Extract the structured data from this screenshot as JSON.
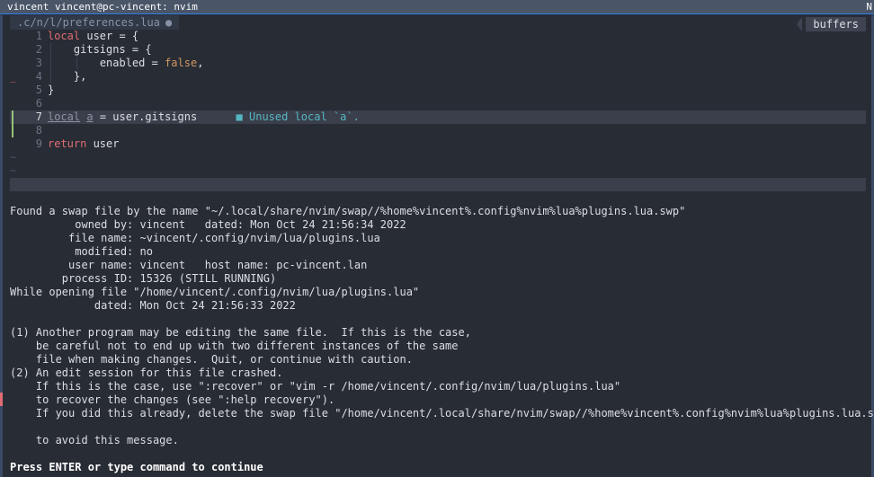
{
  "window": {
    "title": "vincent vincent@pc-vincent: nvim",
    "right_mark": "N"
  },
  "tabline": {
    "file": ".c/n/l/preferences.lua",
    "modified_icon": "●",
    "buffers_label": "buffers"
  },
  "editor": {
    "lines": [
      {
        "num": "1",
        "text": "local user = {"
      },
      {
        "num": "2",
        "text": "    gitsigns = {"
      },
      {
        "num": "3",
        "text": "        enabled = false,"
      },
      {
        "num": "4",
        "text": "    },"
      },
      {
        "num": "5",
        "text": "}"
      },
      {
        "num": "6",
        "text": ""
      },
      {
        "num": "7",
        "text": "local a = user.gitsigns"
      },
      {
        "num": "8",
        "text": ""
      },
      {
        "num": "9",
        "text": "return user"
      }
    ],
    "diagnostic": "■ Unused local `a`.",
    "tilde": "~"
  },
  "message": {
    "lines": [
      "Found a swap file by the name \"~/.local/share/nvim/swap//%home%vincent%.config%nvim%lua%plugins.lua.swp\"",
      "          owned by: vincent   dated: Mon Oct 24 21:56:34 2022",
      "         file name: ~vincent/.config/nvim/lua/plugins.lua",
      "          modified: no",
      "         user name: vincent   host name: pc-vincent.lan",
      "        process ID: 15326 (STILL RUNNING)",
      "While opening file \"/home/vincent/.config/nvim/lua/plugins.lua\"",
      "             dated: Mon Oct 24 21:56:33 2022",
      "",
      "(1) Another program may be editing the same file.  If this is the case,",
      "    be careful not to end up with two different instances of the same",
      "    file when making changes.  Quit, or continue with caution.",
      "(2) An edit session for this file crashed.",
      "    If this is the case, use \":recover\" or \"vim -r /home/vincent/.config/nvim/lua/plugins.lua\"",
      "    to recover the changes (see \":help recovery\").",
      "    If you did this already, delete the swap file \"/home/vincent/.local/share/nvim/swap//%home%vincent%.config%nvim%lua%plugins.lua.swp\"",
      "",
      "    to avoid this message.",
      ""
    ],
    "prompt": "Press ENTER or type command to continue"
  },
  "colors": {
    "background": "#282c34",
    "keyword": "#e06c75",
    "boolean": "#d19a66",
    "diagnostic": "#56b6c2",
    "git_added": "#98c379"
  }
}
